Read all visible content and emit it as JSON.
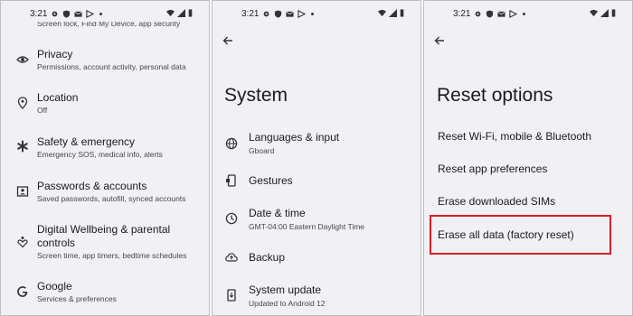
{
  "status": {
    "time": "3:21"
  },
  "panel1": {
    "cut_subtitle": "Screen lock, Find My Device, app security",
    "items": [
      {
        "title": "Privacy",
        "subtitle": "Permissions, account activity, personal data",
        "icon": "eye-icon"
      },
      {
        "title": "Location",
        "subtitle": "Off",
        "icon": "location-pin-icon"
      },
      {
        "title": "Safety & emergency",
        "subtitle": "Emergency SOS, medical info, alerts",
        "icon": "asterisk-icon"
      },
      {
        "title": "Passwords & accounts",
        "subtitle": "Saved passwords, autofill, synced accounts",
        "icon": "account-box-icon"
      },
      {
        "title_line1": "Digital Wellbeing & parental",
        "title_line2": "controls",
        "subtitle": "Screen time, app timers, bedtime schedules",
        "icon": "heart-person-icon"
      },
      {
        "title": "Google",
        "subtitle": "Services & preferences",
        "icon": "google-g-icon"
      }
    ]
  },
  "panel2": {
    "title": "System",
    "items": [
      {
        "title": "Languages & input",
        "subtitle": "Gboard",
        "icon": "globe-icon"
      },
      {
        "title": "Gestures",
        "subtitle": "",
        "icon": "phone-gesture-icon"
      },
      {
        "title": "Date & time",
        "subtitle": "GMT-04:00 Eastern Daylight Time",
        "icon": "clock-icon"
      },
      {
        "title": "Backup",
        "subtitle": "",
        "icon": "cloud-backup-icon"
      },
      {
        "title": "System update",
        "subtitle": "Updated to Android 12",
        "icon": "phone-update-icon"
      }
    ]
  },
  "panel3": {
    "title": "Reset options",
    "options": [
      "Reset Wi-Fi, mobile & Bluetooth",
      "Reset app preferences",
      "Erase downloaded SIMs",
      "Erase all data (factory reset)"
    ],
    "highlight_color": "#d71f26"
  }
}
